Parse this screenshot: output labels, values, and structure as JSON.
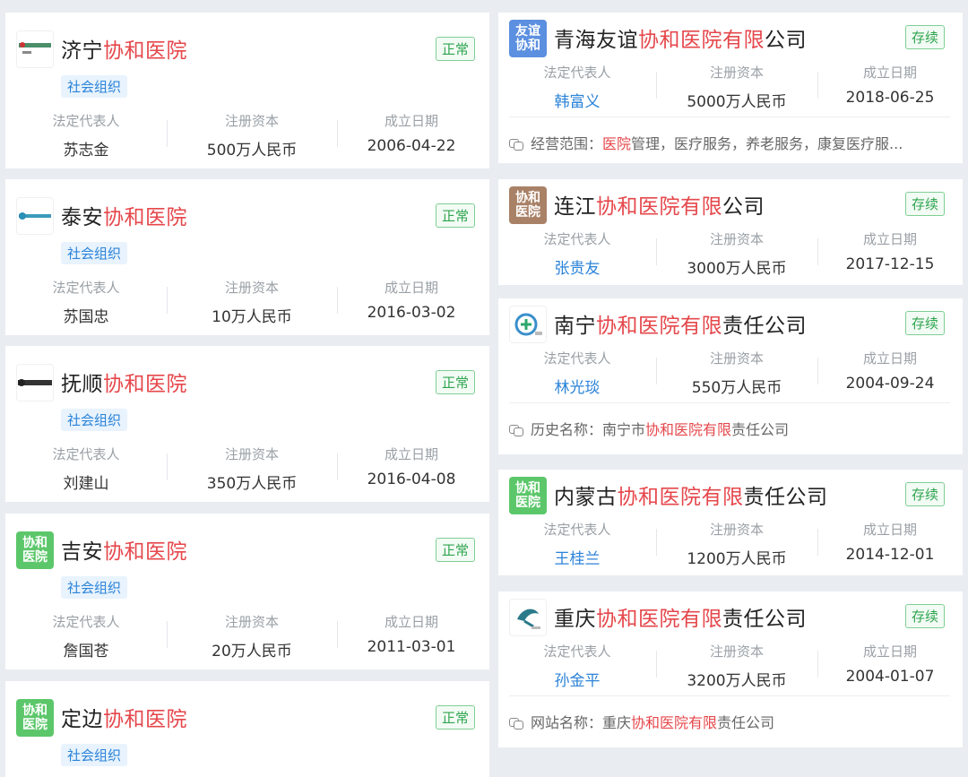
{
  "left_cards": [
    {
      "prefix": "济宁",
      "highlight": "协和医院",
      "suffix": "",
      "logo_type": "img",
      "logo_icon": "jining-hospital-logo",
      "status": "正常",
      "tag": "社会组织",
      "labels": {
        "rep": "法定代表人",
        "capital": "注册资本",
        "date": "成立日期"
      },
      "rep": "苏志金",
      "capital": "500万人民币",
      "date": "2006-04-22"
    },
    {
      "prefix": "泰安",
      "highlight": "协和医院",
      "suffix": "",
      "logo_type": "img",
      "logo_icon": "taian-hospital-logo",
      "status": "正常",
      "tag": "社会组织",
      "labels": {
        "rep": "法定代表人",
        "capital": "注册资本",
        "date": "成立日期"
      },
      "rep": "苏国忠",
      "capital": "10万人民币",
      "date": "2016-03-02"
    },
    {
      "prefix": "抚顺",
      "highlight": "协和医院",
      "suffix": "",
      "logo_type": "img",
      "logo_icon": "fushun-hospital-logo",
      "status": "正常",
      "tag": "社会组织",
      "labels": {
        "rep": "法定代表人",
        "capital": "注册资本",
        "date": "成立日期"
      },
      "rep": "刘建山",
      "capital": "350万人民币",
      "date": "2016-04-08"
    },
    {
      "prefix": "吉安",
      "highlight": "协和医院",
      "suffix": "",
      "logo_type": "txt",
      "logo_text": "协和医院",
      "logo_color": "#5cc76a",
      "status": "正常",
      "tag": "社会组织",
      "labels": {
        "rep": "法定代表人",
        "capital": "注册资本",
        "date": "成立日期"
      },
      "rep": "詹国苍",
      "capital": "20万人民币",
      "date": "2011-03-01"
    },
    {
      "prefix": "定边",
      "highlight": "协和医院",
      "suffix": "",
      "logo_type": "txt",
      "logo_text": "协和医院",
      "logo_color": "#5cc76a",
      "status": "正常",
      "tag": "社会组织"
    }
  ],
  "right_cards": [
    {
      "prefix": "青海友谊",
      "highlight": "协和医院有限",
      "suffix": "公司",
      "logo_type": "txt",
      "logo_text": "友谊协和",
      "logo_color": "#5b8fe0",
      "status": "存续",
      "labels": {
        "rep": "法定代表人",
        "capital": "注册资本",
        "date": "成立日期"
      },
      "rep": "韩富义",
      "capital": "5000万人民币",
      "date": "2018-06-25",
      "extra": {
        "label": "经营范围：",
        "parts": [
          {
            "t": "医院",
            "h": true
          },
          {
            "t": "管理，医疗服务，养老服务，康复医疗服...",
            "h": false
          }
        ]
      }
    },
    {
      "prefix": "连江",
      "highlight": "协和医院有限",
      "suffix": "公司",
      "logo_type": "txt",
      "logo_text": "协和医院",
      "logo_color": "#a98167",
      "status": "存续",
      "labels": {
        "rep": "法定代表人",
        "capital": "注册资本",
        "date": "成立日期"
      },
      "rep": "张贵友",
      "capital": "3000万人民币",
      "date": "2017-12-15"
    },
    {
      "prefix": "南宁",
      "highlight": "协和医院有限",
      "suffix": "责任公司",
      "logo_type": "img",
      "logo_icon": "nanning-hospital-logo",
      "status": "存续",
      "labels": {
        "rep": "法定代表人",
        "capital": "注册资本",
        "date": "成立日期"
      },
      "rep": "林光琰",
      "capital": "550万人民币",
      "date": "2004-09-24",
      "extra": {
        "label": "历史名称：",
        "parts": [
          {
            "t": "南宁市",
            "h": false
          },
          {
            "t": "协和医院有限",
            "h": true
          },
          {
            "t": "责任公司",
            "h": false
          }
        ]
      }
    },
    {
      "prefix": "内蒙古",
      "highlight": "协和医院有限",
      "suffix": "责任公司",
      "logo_type": "txt",
      "logo_text": "协和医院",
      "logo_color": "#5cc76a",
      "status": "存续",
      "labels": {
        "rep": "法定代表人",
        "capital": "注册资本",
        "date": "成立日期"
      },
      "rep": "王桂兰",
      "capital": "1200万人民币",
      "date": "2014-12-01"
    },
    {
      "prefix": "重庆",
      "highlight": "协和医院有限",
      "suffix": "责任公司",
      "logo_type": "img",
      "logo_icon": "chongqing-hospital-logo",
      "status": "存续",
      "labels": {
        "rep": "法定代表人",
        "capital": "注册资本",
        "date": "成立日期"
      },
      "rep": "孙金平",
      "capital": "3200万人民币",
      "date": "2004-01-07",
      "extra": {
        "label": "网站名称：",
        "parts": [
          {
            "t": "重庆",
            "h": false
          },
          {
            "t": "协和医院有限",
            "h": true
          },
          {
            "t": "责任公司",
            "h": false
          }
        ]
      }
    }
  ]
}
